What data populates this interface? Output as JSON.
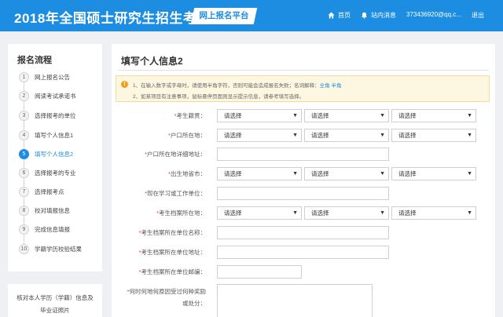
{
  "header": {
    "title": "2018年全国硕士研究生招生考试",
    "platform": "网上报名平台",
    "nav": {
      "home": "首页",
      "messages": "站内消息",
      "user": "373436920@qq.c...",
      "logout": "退出"
    }
  },
  "sidebar": {
    "title": "报名流程",
    "steps": [
      {
        "num": "1",
        "label": "网上报名公告"
      },
      {
        "num": "2",
        "label": "阅读考试承诺书"
      },
      {
        "num": "3",
        "label": "选择报考的单位"
      },
      {
        "num": "4",
        "label": "填写个人信息1"
      },
      {
        "num": "5",
        "label": "填写个人信息2"
      },
      {
        "num": "6",
        "label": "选择报考的专业"
      },
      {
        "num": "7",
        "label": "选择报考点"
      },
      {
        "num": "8",
        "label": "校对填报信息"
      },
      {
        "num": "9",
        "label": "完成信息填报"
      },
      {
        "num": "10",
        "label": "学籍学历校验结果"
      }
    ],
    "active_step": 5,
    "footer": {
      "line1": "核对本人学历（学籍）信息及",
      "line2": "毕业证照片"
    }
  },
  "main": {
    "title": "填写个人信息2",
    "notice": {
      "line1": "1、在输入数字或字母时，请使用半角字符，否则可能会造成报名失败；名词解释：",
      "link1": "全角",
      "link2": "半角",
      "line2": "2、如某项目有注意事项，鼠标悬停页面则显示提示信息，请参考填写选择。"
    },
    "placeholder": "请选择",
    "fields": {
      "native_place": "考生籍贯：",
      "hukou": "户口所在地：",
      "hukou_address": "户口所在地详细地址：",
      "birthplace": "出生地省市：",
      "work_unit": "现在学习或工作单位：",
      "archive_location": "考生档案所在地：",
      "archive_unit_name": "考生档案所在单位名称：",
      "archive_unit_address": "考生档案所在单位地址：",
      "archive_unit_postcode": "考生档案所在单位邮编：",
      "rewards": "何时何地何原因受过何种奖励",
      "rewards_2": "或处分："
    }
  },
  "colors": {
    "header": "#1c8de0",
    "accent": "#1c8de0",
    "notice_bg": "#fdf7e2",
    "required": "#e03a3a"
  }
}
